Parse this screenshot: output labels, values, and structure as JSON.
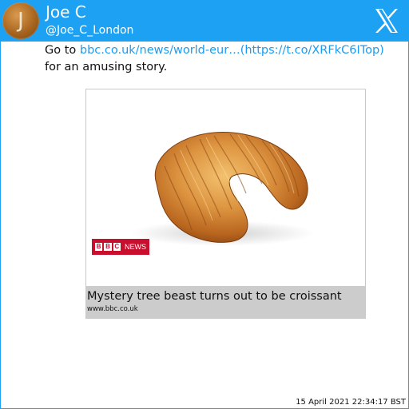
{
  "header": {
    "avatar_letter": "J",
    "name": "Joe C",
    "handle": "@Joe_C_London",
    "logo_icon": "x-logo-icon"
  },
  "tweet": {
    "prefix": "Go to ",
    "link_text": "bbc.co.uk/news/world-eur…(https://t.co/XRFkC6ITop)",
    "suffix": " for an amusing story."
  },
  "card": {
    "image_alt": "croissant",
    "logo_text_blocks": [
      "B",
      "B",
      "C"
    ],
    "logo_word": "NEWS",
    "title": "Mystery tree beast turns out to be croissant",
    "domain": "www.bbc.co.uk"
  },
  "timestamp": "15 April 2021 22:34:17 BST",
  "colors": {
    "header_bg": "#1da1f2",
    "link": "#1d9bf0",
    "card_footer": "#cccccc",
    "bbc_red": "#c8102e"
  }
}
